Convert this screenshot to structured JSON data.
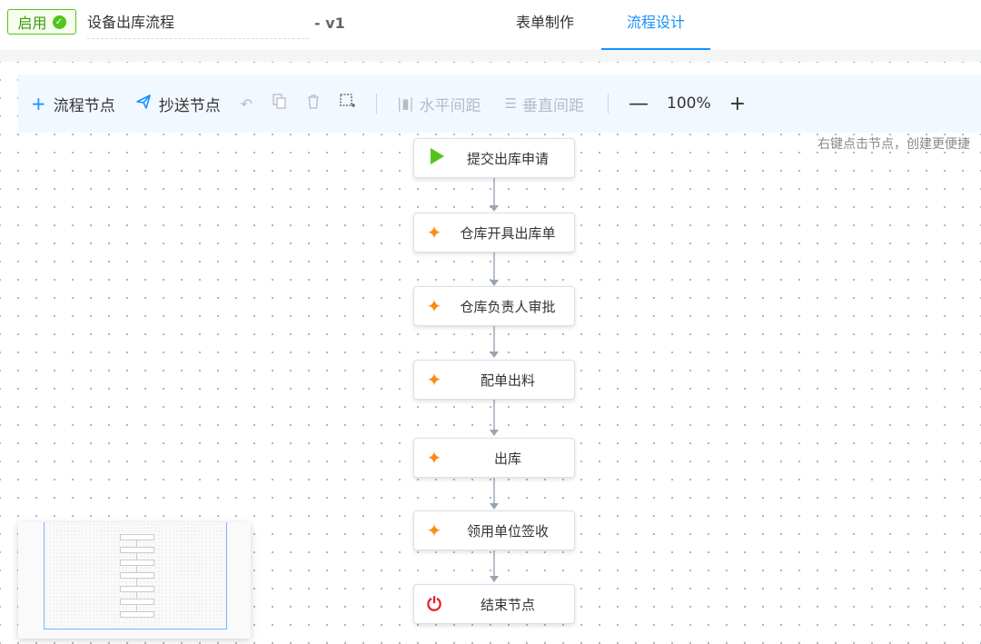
{
  "header": {
    "status_label": "启用",
    "flow_name": "设备出库流程",
    "version": "- v1",
    "tabs": [
      {
        "label": "表单制作",
        "active": false
      },
      {
        "label": "流程设计",
        "active": true
      }
    ]
  },
  "toolbar": {
    "add_node": "流程节点",
    "cc_node": "抄送节点",
    "horizontal_spacing": "水平间距",
    "vertical_spacing": "垂直间距",
    "zoom_level": "100%",
    "zoom_out": "—",
    "zoom_in": "+"
  },
  "hint": "右键点击节点，创建更便捷",
  "nodes": [
    {
      "label": "提交出库申请",
      "icon": "play-icon"
    },
    {
      "label": "仓库开具出库单",
      "icon": "sparkle-icon"
    },
    {
      "label": "仓库负责人审批",
      "icon": "sparkle-icon"
    },
    {
      "label": "配单出料",
      "icon": "sparkle-icon"
    },
    {
      "label": "出库",
      "icon": "sparkle-icon"
    },
    {
      "label": "领用单位签收",
      "icon": "sparkle-icon"
    },
    {
      "label": "结束节点",
      "icon": "power-icon"
    }
  ],
  "colors": {
    "accent": "#1890ff",
    "status_green": "#52c41a",
    "task_orange": "#fa8c16",
    "end_red": "#e0202a"
  }
}
